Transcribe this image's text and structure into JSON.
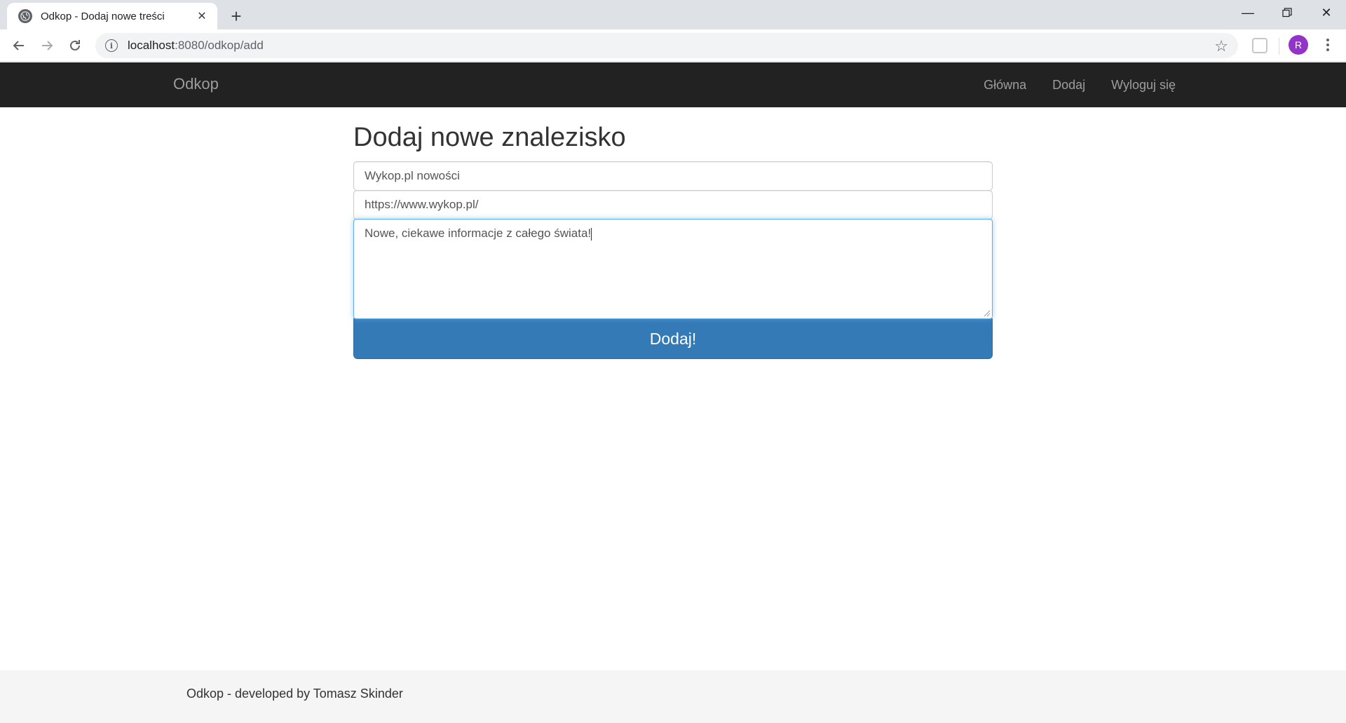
{
  "browser": {
    "tab_title": "Odkop - Dodaj nowe treści",
    "url_host": "localhost",
    "url_rest": ":8080/odkop/add",
    "avatar_letter": "R"
  },
  "navbar": {
    "brand": "Odkop",
    "links": [
      "Główna",
      "Dodaj",
      "Wyloguj się"
    ]
  },
  "form": {
    "heading": "Dodaj nowe znalezisko",
    "title_value": "Wykop.pl nowości",
    "url_value": "https://www.wykop.pl/",
    "description_value": "Nowe, ciekawe informacje z całego świata!",
    "submit_label": "Dodaj!"
  },
  "footer": {
    "text": "Odkop - developed by Tomasz Skinder"
  },
  "colors": {
    "navbar_bg": "#222222",
    "primary": "#337ab7",
    "focus": "#66afe9"
  }
}
